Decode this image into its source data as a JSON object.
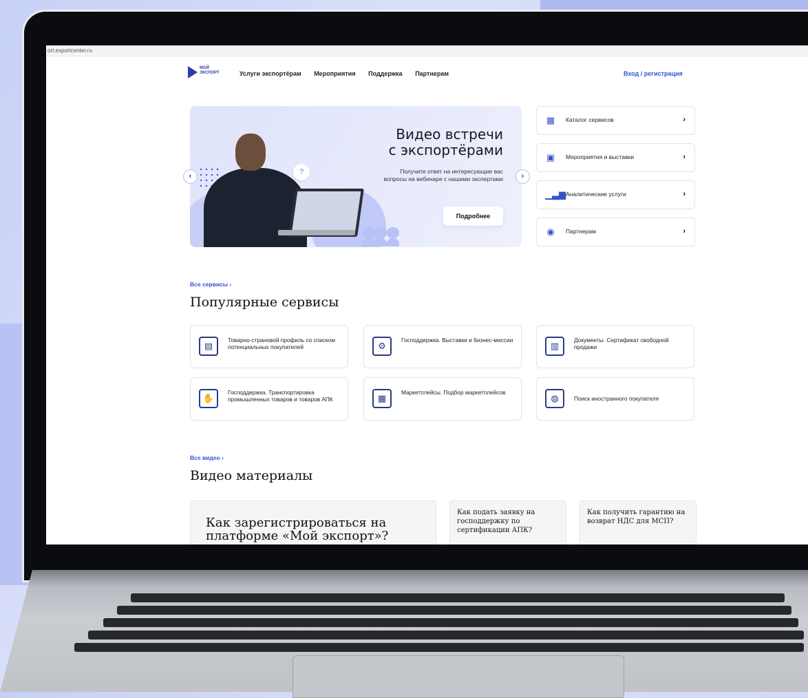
{
  "browser": {
    "url": "ort.exportcenter.ru"
  },
  "header": {
    "logo_line1": "МОЙ",
    "logo_line2": "ЭКСПОРТ",
    "nav": [
      "Услуги экспортёрам",
      "Мероприятия",
      "Поддержка",
      "Партнерам"
    ],
    "login": "Вход / регистрация"
  },
  "hero": {
    "title_line1": "Видео встречи",
    "title_line2": "с экспортёрами",
    "subtitle": "Получите ответ на интересующие вас вопросы на вебинаре с нашими экспертами",
    "button": "Подробнее",
    "prev": "‹",
    "next": "›",
    "question_mark": "?"
  },
  "side_menu": [
    {
      "icon": "catalog-icon",
      "label": "Каталог сервисов"
    },
    {
      "icon": "calendar-icon",
      "label": "Мероприятия и выставки"
    },
    {
      "icon": "analytics-chart-icon",
      "label": "Аналитические услуги"
    },
    {
      "icon": "partners-icon",
      "label": "Партнерам"
    }
  ],
  "popular": {
    "link": "Все сервисы",
    "title": "Популярные сервисы",
    "cards": [
      {
        "icon": "profile-document-icon",
        "label": "Товарно-страновой профиль со списком потенциальных покупателей"
      },
      {
        "icon": "gears-icon",
        "label": "Господдержка. Выставки и бизнес-миссии"
      },
      {
        "icon": "certificate-icon",
        "label": "Документы. Сертификат свободной продажи"
      },
      {
        "icon": "transport-hand-icon",
        "label": "Господдержка. Транспортировка промышленных товаров и товаров АПК"
      },
      {
        "icon": "marketplace-icon",
        "label": "Маркетплейсы. Подбор маркетплейсов"
      },
      {
        "icon": "globe-hands-icon",
        "label": "Поиск иностранного покупателя"
      }
    ]
  },
  "videos": {
    "link": "Все видео",
    "title": "Видео материалы",
    "items": [
      {
        "title": "Как зарегистрироваться на платформе «Мой экспорт»?"
      },
      {
        "title": "Как подать заявку на господдержку по сертификации АПК?"
      },
      {
        "title": "Как получить гарантию на возврат НДС для МСП?"
      }
    ]
  },
  "colors": {
    "accent": "#2f55d4",
    "brand": "#2d3ea8",
    "hero_bg": "#e3e7fb"
  }
}
